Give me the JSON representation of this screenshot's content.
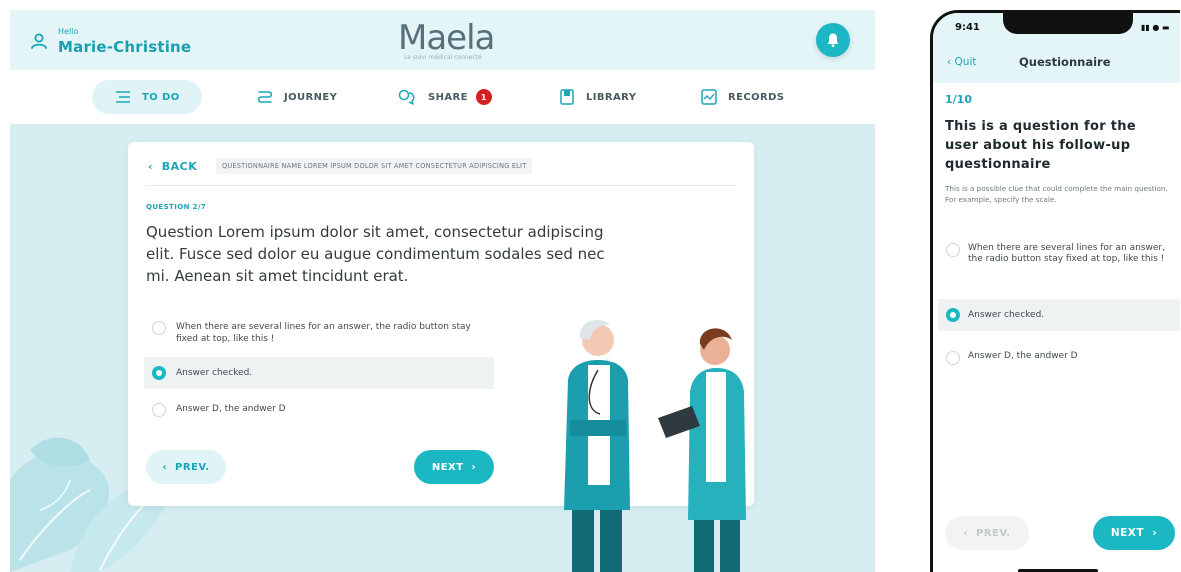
{
  "desktop": {
    "user": {
      "greeting": "Hello",
      "name": "Marie-Christine"
    },
    "logo": {
      "text": "Maela",
      "tagline": "Le suivi médical connecté"
    },
    "nav": [
      {
        "label": "TO DO",
        "icon": "list-icon",
        "active": true
      },
      {
        "label": "JOURNEY",
        "icon": "path-icon",
        "active": false
      },
      {
        "label": "SHARE",
        "icon": "share-chat-icon",
        "active": false,
        "badge": "1"
      },
      {
        "label": "LIBRARY",
        "icon": "book-icon",
        "active": false
      },
      {
        "label": "RECORDS",
        "icon": "records-icon",
        "active": false
      }
    ],
    "card": {
      "back_label": "BACK",
      "questionnaire_name": "QUESTIONNAIRE NAME LOREM IPSUM DOLOR SIT AMET CONSECTETUR ADIPISCING ELIT",
      "question_number": "QUESTION 2/7",
      "question_text": "Question Lorem ipsum dolor sit amet, consectetur adipiscing elit. Fusce sed dolor eu augue condimentum sodales sed nec mi. Aenean sit amet tincidunt erat.",
      "answers": [
        {
          "text": "When there are several lines for an answer, the radio button stay fixed at top, like this !",
          "checked": false
        },
        {
          "text": "Answer checked.",
          "checked": true
        },
        {
          "text": "Answer D, the andwer D",
          "checked": false
        }
      ],
      "prev_label": "PREV.",
      "next_label": "NEXT"
    }
  },
  "mobile": {
    "status": {
      "time": "9:41"
    },
    "header": {
      "quit_label": "Quit",
      "title": "Questionnaire"
    },
    "progress": "1/10",
    "question": "This is a question for the user about his follow-up questionnaire",
    "clue": "This is a possible clue that could complete the main question. For example, specify the scale.",
    "answers": [
      {
        "text": "When there are several lines for an answer, the radio button stay fixed at top, like this !",
        "checked": false
      },
      {
        "text": "Answer checked.",
        "checked": true
      },
      {
        "text": "Answer D, the andwer D",
        "checked": false
      }
    ],
    "prev_label": "PREV.",
    "next_label": "NEXT"
  },
  "colors": {
    "accent": "#1bb8c4",
    "header_bg": "#e4f5f8",
    "content_bg": "#d6eef1",
    "badge": "#d42020"
  }
}
